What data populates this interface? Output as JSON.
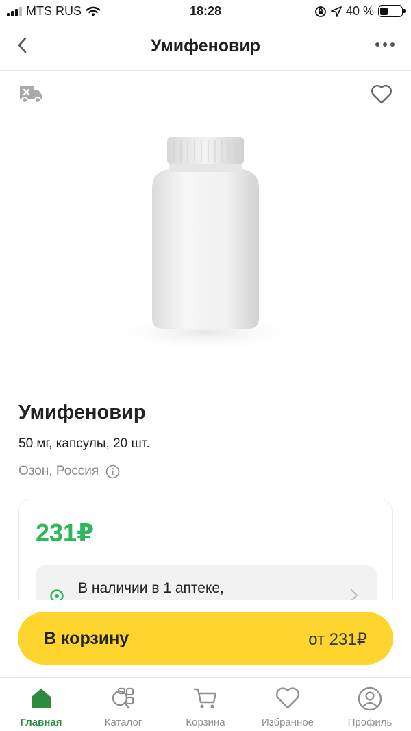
{
  "status_bar": {
    "carrier": "MTS RUS",
    "time": "18:28",
    "battery": "40 %"
  },
  "header": {
    "title": "Умифеновир"
  },
  "product": {
    "name": "Умифеновир",
    "details": "50 мг, капсулы, 20 шт.",
    "manufacturer": "Озон, Россия",
    "price": "231₽",
    "availability": "В наличии в 1 аптеке,"
  },
  "cart": {
    "label": "В корзину",
    "price": "от 231₽"
  },
  "tabs": [
    {
      "label": "Главная",
      "icon": "home-icon",
      "active": true
    },
    {
      "label": "Каталог",
      "icon": "catalog-icon",
      "active": false
    },
    {
      "label": "Корзина",
      "icon": "cart-icon",
      "active": false
    },
    {
      "label": "Избранное",
      "icon": "heart-icon",
      "active": false
    },
    {
      "label": "Профиль",
      "icon": "profile-icon",
      "active": false
    }
  ],
  "colors": {
    "accent_green": "#2bb75a",
    "active_tab_green": "#2e8b3e",
    "cart_button_yellow": "#fed52e"
  }
}
